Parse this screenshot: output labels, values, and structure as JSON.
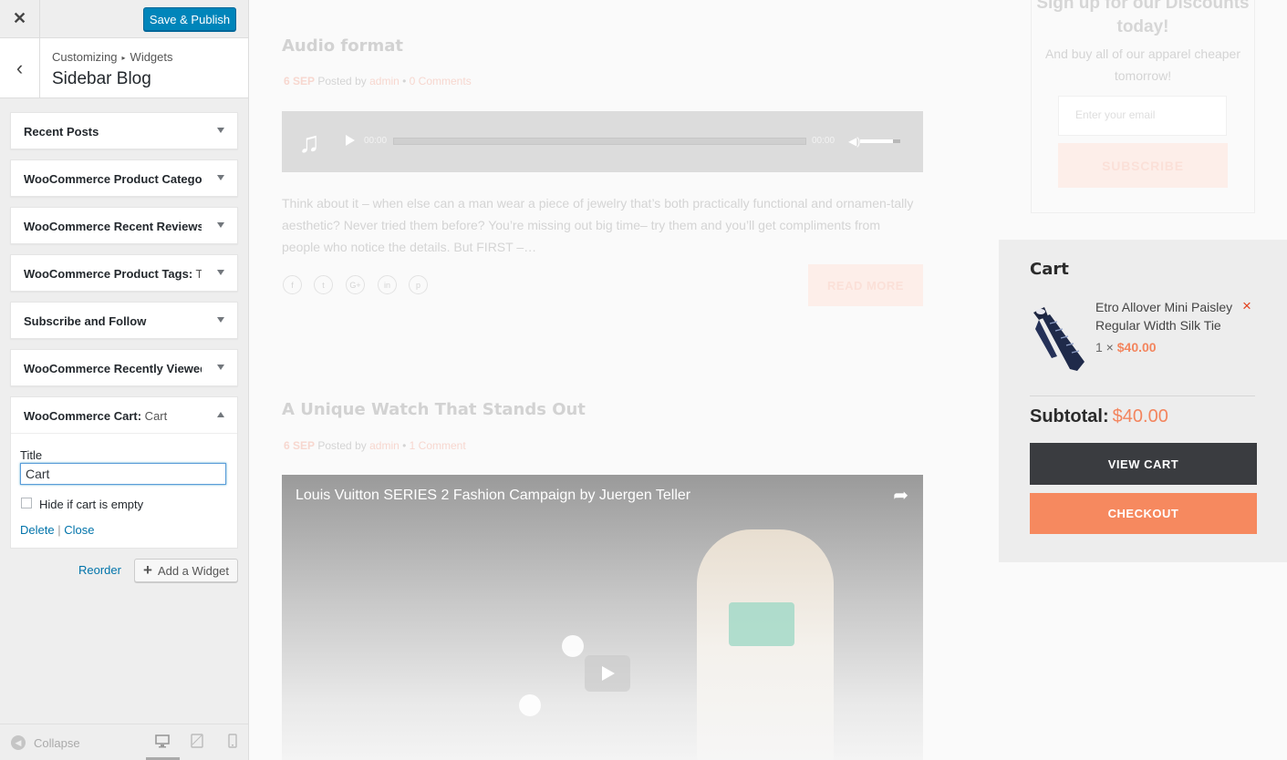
{
  "header": {
    "close_icon": "close-icon",
    "save_label": "Save & Publish"
  },
  "breadcrumb": {
    "root": "Customizing",
    "section": "Widgets",
    "title": "Sidebar Blog"
  },
  "widgets": [
    {
      "title": "Recent Posts",
      "instance": ""
    },
    {
      "title": "WooCommerce Product Catego...",
      "instance": ""
    },
    {
      "title": "WooCommerce Recent Reviews...",
      "instance": ""
    },
    {
      "title": "WooCommerce Product Tags:",
      "instance": " T..."
    },
    {
      "title": "Subscribe and Follow",
      "instance": ""
    },
    {
      "title": "WooCommerce Recently Viewed",
      "instance": ""
    }
  ],
  "open_widget": {
    "title": "WooCommerce Cart:",
    "instance": " Cart",
    "field_label": "Title",
    "field_value": "Cart",
    "checkbox_label": "Hide if cart is empty",
    "delete_label": "Delete",
    "separator": "|",
    "close_label": "Close"
  },
  "actions": {
    "reorder_label": "Reorder",
    "add_widget_label": "Add a Widget"
  },
  "footer": {
    "collapse_label": "Collapse"
  },
  "posts": [
    {
      "title": "Audio format",
      "date": "6 SEP",
      "posted_by": "Posted by",
      "author": "admin",
      "comments": "0 Comments",
      "time_start": "00:00",
      "time_end": "00:00",
      "excerpt": "Think about it – when else can a man wear a piece of jewelry that’s both practically functional and ornamen-tally aesthetic? Never tried them before? You’re missing out big time– try them and you’ll get compliments from people who notice the details. But FIRST –…",
      "read_more": "READ MORE"
    },
    {
      "title": "A Unique Watch That Stands Out",
      "date": "6 SEP",
      "posted_by": "Posted by",
      "author": "admin",
      "comments": "1 Comment",
      "video_title": "Louis Vuitton SERIES 2 Fashion Campaign by Juergen Teller"
    }
  ],
  "signup": {
    "heading": "Sign up for our Discounts today!",
    "subtext": "And buy all of our apparel cheaper tomorrow!",
    "email_placeholder": "Enter your email",
    "subscribe_label": "SUBSCRIBE"
  },
  "cart": {
    "title": "Cart",
    "product_name": "Etro Allover Mini Paisley Regular Width Silk Tie",
    "qty_text": "1 ×",
    "price": "$40.00",
    "remove": "×",
    "subtotal_label": "Subtotal:",
    "subtotal_value": "$40.00",
    "view_cart": "VIEW CART",
    "checkout": "CHECKOUT"
  },
  "colors": {
    "primary_button": "#0085ba",
    "link": "#0073aa",
    "accent": "#f6895f",
    "dark_button": "#3a3c40"
  }
}
